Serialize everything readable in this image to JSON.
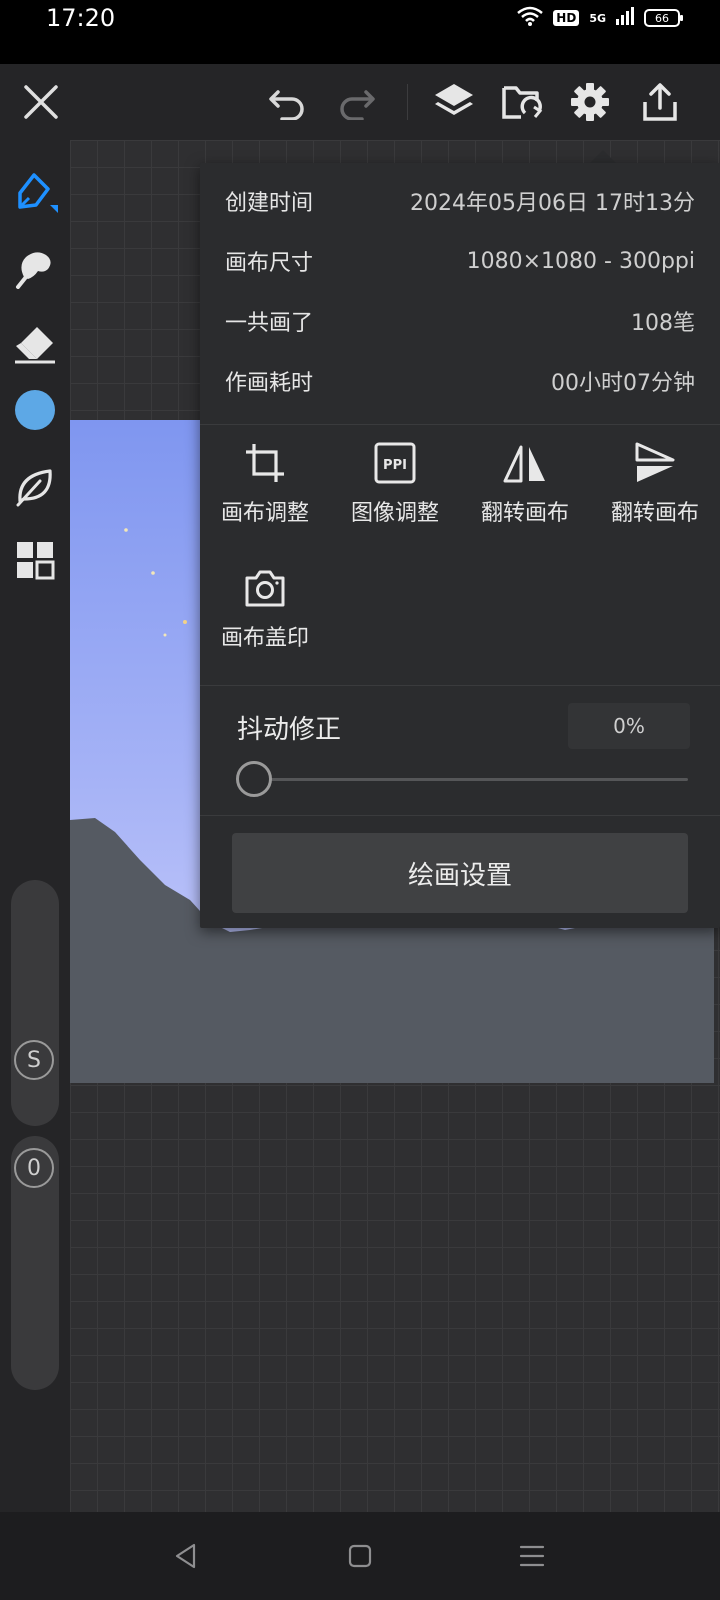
{
  "status_bar": {
    "time": "17:20",
    "hd": "HD",
    "network": "5G",
    "battery": "66"
  },
  "toolbar": {
    "close_icon": "close-icon",
    "undo_icon": "undo-icon",
    "redo_icon": "redo-icon",
    "layers_icon": "layers-icon",
    "import_icon": "folder-import-icon",
    "settings_icon": "gear-icon",
    "share_icon": "share-icon"
  },
  "left_tools": {
    "items": [
      "brush-icon",
      "smudge-icon",
      "eraser-icon",
      "color-swatch",
      "leaf-icon",
      "grid-icon"
    ],
    "current_color": "#5da8e6",
    "accent_color": "#1e90ff",
    "size_knob": "S",
    "opacity_knob": "0"
  },
  "panel": {
    "info": [
      {
        "label": "创建时间",
        "value": "2024年05月06日 17时13分"
      },
      {
        "label": "画布尺寸",
        "value": "1080×1080 - 300ppi"
      },
      {
        "label": "一共画了",
        "value": "108笔"
      },
      {
        "label": "作画耗时",
        "value": "00小时07分钟"
      }
    ],
    "actions": [
      {
        "label": "画布调整",
        "icon": "crop-icon"
      },
      {
        "label": "图像调整",
        "icon": "ppi-icon"
      },
      {
        "label": "翻转画布",
        "icon": "flip-horizontal-icon"
      },
      {
        "label": "翻转画布",
        "icon": "flip-vertical-icon"
      },
      {
        "label": "画布盖印",
        "icon": "camera-icon"
      }
    ],
    "jitter": {
      "label": "抖动修正",
      "value_text": "0%",
      "value": 0
    },
    "settings_button": "绘画设置"
  },
  "nav": {
    "back_icon": "back-triangle-icon",
    "home_icon": "home-square-icon",
    "menu_icon": "menu-lines-icon"
  }
}
